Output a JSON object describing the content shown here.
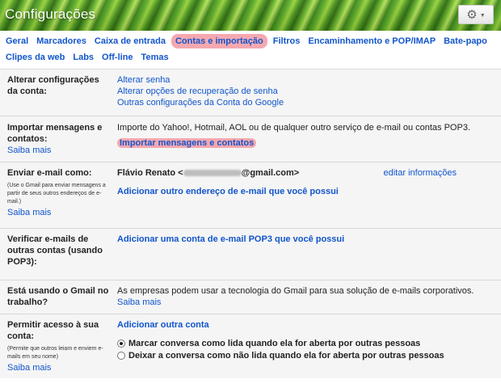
{
  "header": {
    "title": "Configurações"
  },
  "tabs_row1": [
    "Geral",
    "Marcadores",
    "Caixa de entrada",
    "Contas e importação",
    "Filtros",
    "Encaminhamento e POP/IMAP",
    "Bate-papo"
  ],
  "tabs_row2": [
    "Clipes da web",
    "Labs",
    "Off-line",
    "Temas"
  ],
  "active_tab": "Contas e importação",
  "learn_more": "Saiba mais",
  "sections": {
    "change_account": {
      "label": "Alterar configurações da conta:",
      "links": [
        "Alterar senha",
        "Alterar opções de recuperação de senha",
        "Outras configurações da Conta do Google"
      ]
    },
    "import": {
      "label": "Importar mensagens e contatos:",
      "description": "Importe do Yahoo!, Hotmail, AOL ou de qualquer outro serviço de e-mail ou contas POP3.",
      "action": "Importar mensagens e contatos"
    },
    "send_as": {
      "label": "Enviar e-mail como:",
      "note": "(Use o Gmail para enviar mensagens a partir de seus outros endereços de e-mail.)",
      "sender_prefix": "Flávio Renato <",
      "sender_suffix": "@gmail.com>",
      "edit": "editar informações",
      "add": "Adicionar outro endereço de e-mail que você possui"
    },
    "check_mail": {
      "label": "Verificar e-mails de outras contas (usando POP3):",
      "add": "Adicionar uma conta de e-mail POP3 que você possui"
    },
    "work": {
      "label": "Está usando o Gmail no trabalho?",
      "text": "As empresas podem usar a tecnologia do Gmail para sua solução de e-mails corporativos."
    },
    "grant": {
      "label": "Permitir acesso à sua conta:",
      "note": "(Permite que outros leiam e enviem e-mails em seu nome)",
      "add": "Adicionar outra conta",
      "option1": "Marcar conversa como lida quando ela for aberta por outras pessoas",
      "option2": "Deixar a conversa como não lida quando ela for aberta por outras pessoas",
      "selected": 1
    }
  }
}
